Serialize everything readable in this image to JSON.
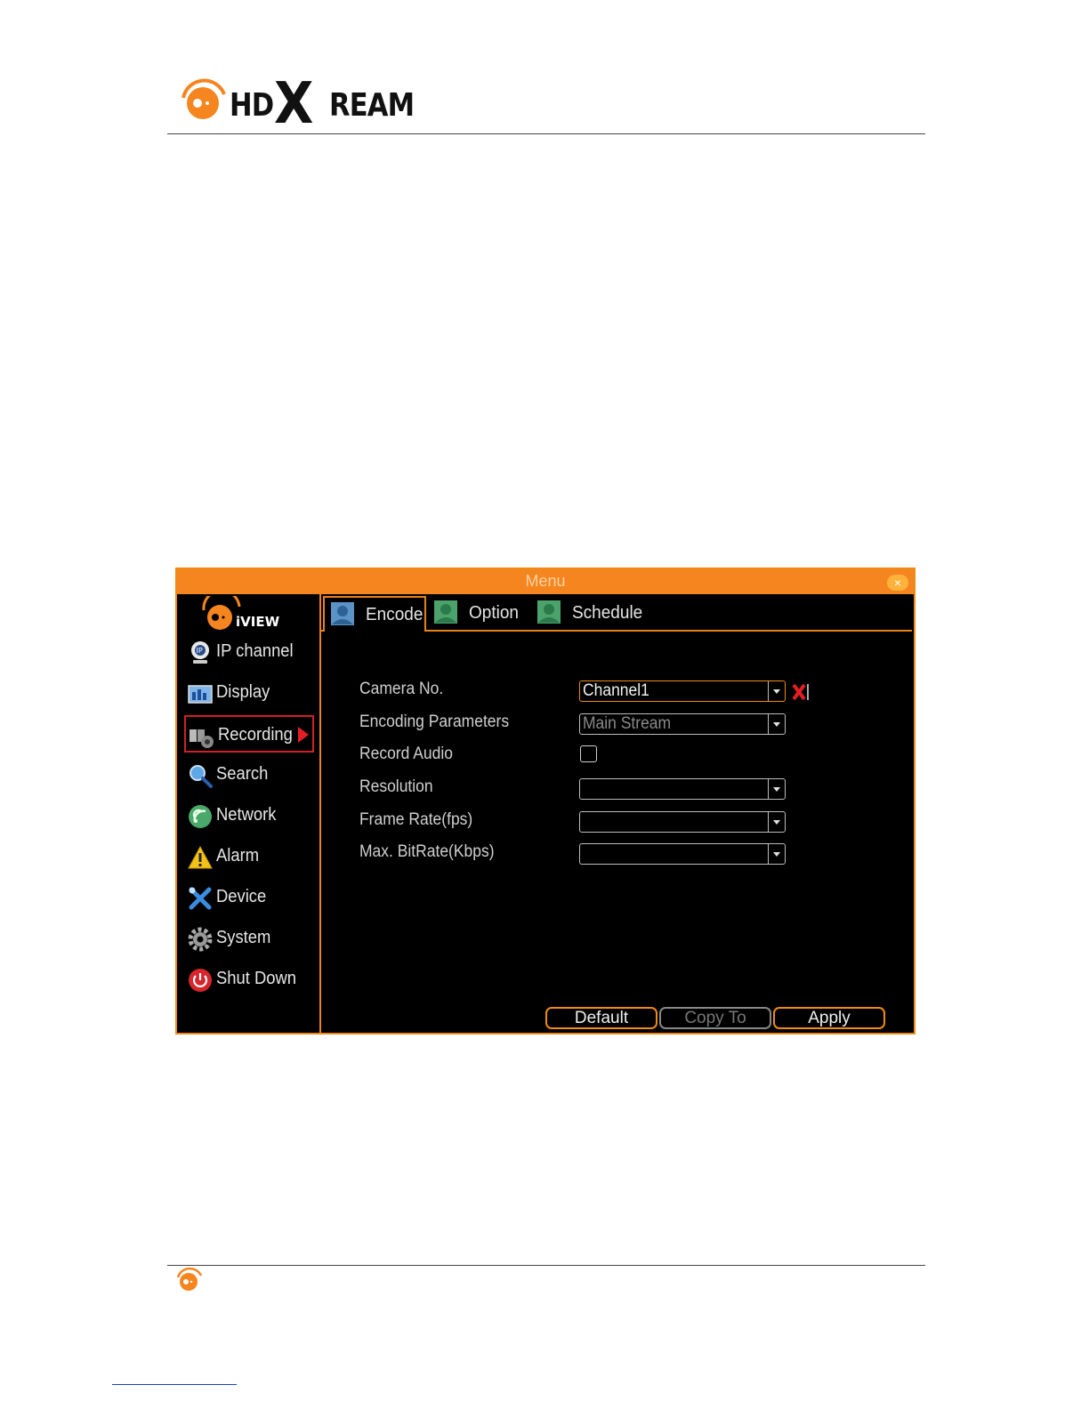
{
  "document": {
    "brand": {
      "part1": "HD",
      "part2": "X",
      "part3": "REAM"
    }
  },
  "window": {
    "title": "Menu",
    "close_glyph": "×",
    "logo_text": "iVIEW",
    "sidebar": {
      "items": [
        {
          "label": "IP channel",
          "icon": "ip-camera-icon"
        },
        {
          "label": "Display",
          "icon": "display-icon"
        },
        {
          "label": "Recording",
          "icon": "recording-icon",
          "active": true
        },
        {
          "label": "Search",
          "icon": "search-icon"
        },
        {
          "label": "Network",
          "icon": "network-icon"
        },
        {
          "label": "Alarm",
          "icon": "alarm-icon"
        },
        {
          "label": "Device",
          "icon": "device-icon"
        },
        {
          "label": "System",
          "icon": "gear-icon"
        },
        {
          "label": "Shut Down",
          "icon": "power-icon"
        }
      ]
    },
    "tabs": [
      {
        "label": "Encode",
        "active": true
      },
      {
        "label": "Option"
      },
      {
        "label": "Schedule"
      }
    ],
    "form": {
      "camera_no": {
        "label": "Camera No.",
        "value": "Channel1"
      },
      "encoding_parameters": {
        "label": "Encoding Parameters",
        "value": "Main Stream"
      },
      "record_audio": {
        "label": "Record Audio",
        "checked": false
      },
      "resolution": {
        "label": "Resolution",
        "value": ""
      },
      "frame_rate": {
        "label": "Frame Rate(fps)",
        "value": ""
      },
      "max_bitrate": {
        "label": "Max. BitRate(Kbps)",
        "value": ""
      }
    },
    "buttons": {
      "default": "Default",
      "copy_to": "Copy To",
      "apply": "Apply"
    },
    "colors": {
      "accent": "#f5851f",
      "highlight": "#d0202a",
      "background": "#000000"
    }
  }
}
